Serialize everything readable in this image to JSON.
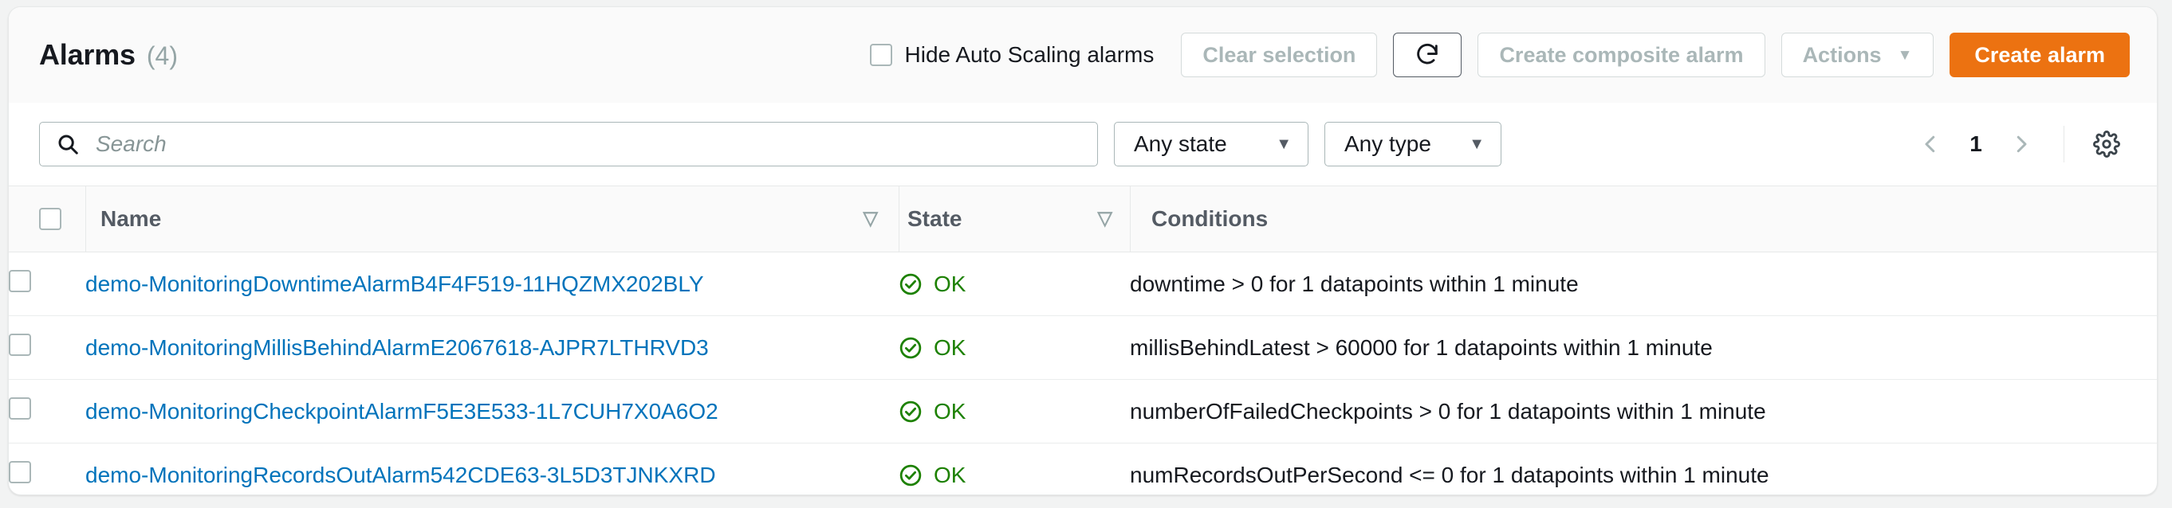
{
  "header": {
    "title": "Alarms",
    "count": "(4)",
    "hide_autoscaling_label": "Hide Auto Scaling alarms",
    "hide_autoscaling_checked": false,
    "clear_selection_label": "Clear selection",
    "refresh_icon": "refresh-icon",
    "create_composite_label": "Create composite alarm",
    "actions_label": "Actions",
    "actions_caret": "▼",
    "create_alarm_label": "Create alarm",
    "accent_color": "#ec7211"
  },
  "filters": {
    "search_placeholder": "Search",
    "search_value": "",
    "search_icon": "search-icon",
    "state_filter": "Any state",
    "type_filter": "Any type",
    "caret": "▼",
    "pagination": {
      "prev_icon": "chevron-left-icon",
      "page": "1",
      "next_icon": "chevron-right-icon"
    },
    "settings_icon": "gear-icon"
  },
  "table": {
    "columns": [
      {
        "key": "select",
        "label": ""
      },
      {
        "key": "name",
        "label": "Name",
        "sortable": true
      },
      {
        "key": "state",
        "label": "State",
        "sortable": true
      },
      {
        "key": "conditions",
        "label": "Conditions",
        "sortable": false
      }
    ],
    "sort_caret": "▽",
    "rows": [
      {
        "selected": false,
        "name": "demo-MonitoringDowntimeAlarmB4F4F519-11HQZMX202BLY",
        "state": "OK",
        "state_icon": "check-circle-icon",
        "state_color": "#1d8102",
        "conditions": "downtime > 0 for 1 datapoints within 1 minute"
      },
      {
        "selected": false,
        "name": "demo-MonitoringMillisBehindAlarmE2067618-AJPR7LTHRVD3",
        "state": "OK",
        "state_icon": "check-circle-icon",
        "state_color": "#1d8102",
        "conditions": "millisBehindLatest > 60000 for 1 datapoints within 1 minute"
      },
      {
        "selected": false,
        "name": "demo-MonitoringCheckpointAlarmF5E3E533-1L7CUH7X0A6O2",
        "state": "OK",
        "state_icon": "check-circle-icon",
        "state_color": "#1d8102",
        "conditions": "numberOfFailedCheckpoints > 0 for 1 datapoints within 1 minute"
      },
      {
        "selected": false,
        "name": "demo-MonitoringRecordsOutAlarm542CDE63-3L5D3TJNKXRD",
        "state": "OK",
        "state_icon": "check-circle-icon",
        "state_color": "#1d8102",
        "conditions": "numRecordsOutPerSecond <= 0 for 1 datapoints within 1 minute"
      }
    ]
  }
}
